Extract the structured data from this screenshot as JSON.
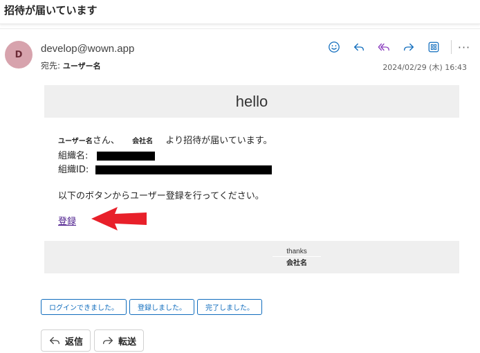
{
  "subject": "招待が届いています",
  "header": {
    "avatar_initial": "D",
    "sender": "develop@wown.app",
    "to_label": "宛先:",
    "to_name": "ユーザー名",
    "date": "2024/02/29 (木) 16:43"
  },
  "toolbar": {
    "icons": [
      "emoji-icon",
      "reply-icon",
      "reply-all-icon",
      "forward-icon",
      "apps-icon",
      "more-icon"
    ],
    "more": "···",
    "accent_color": "#0f6cbd"
  },
  "body": {
    "hello": "hello",
    "line1_user": "ユーザー名",
    "line1_san": "さん、",
    "line1_company": "会社名",
    "line1_rest": "より招待が届いています。",
    "org_name_label": "組織名:",
    "org_id_label": "組織ID:",
    "instruction": "以下のボタンからユーザー登録を行ってください。",
    "register_link": "登録",
    "thanks": "thanks",
    "thanks_company": "会社名"
  },
  "quick_replies": [
    "ログインできました。",
    "登録しました。",
    "完了しました。"
  ],
  "actions": {
    "reply": "返信",
    "forward": "転送"
  },
  "annotation_arrow_color": "#e8202a"
}
